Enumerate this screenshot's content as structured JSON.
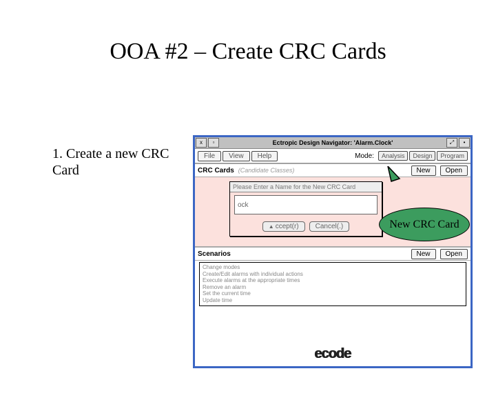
{
  "slide": {
    "title": "OOA #2 – Create CRC Cards",
    "step": "1.  Create a new CRC Card"
  },
  "window": {
    "title": "Ectropic Design Navigator: 'Alarm.Clock'",
    "controls": {
      "close": "x",
      "minimize": "▫",
      "grow": "⤢",
      "dot": "•"
    },
    "menu": {
      "file": "File",
      "view": "View",
      "help": "Help"
    },
    "mode": {
      "label": "Mode:",
      "analysis": "Analysis",
      "design": "Design",
      "program": "Program"
    },
    "crc": {
      "section": "CRC Cards",
      "hint": "(Candidate Classes)",
      "new": "New",
      "open": "Open",
      "dialog": {
        "title": "Please Enter a Name for the New CRC Card",
        "value": "ock",
        "accept": "ccept(r)",
        "cancel": "Cancel(.)"
      }
    },
    "scenarios": {
      "section": "Scenarios",
      "new": "New",
      "open": "Open",
      "items": [
        "Change modes",
        "Create/Edit alarms with individual actions",
        "Execute alarms at the appropriate times",
        "Remove an alarm",
        "Set the current time",
        "Update time"
      ]
    },
    "logo": "ecode"
  },
  "callout": {
    "text": "New CRC Card"
  }
}
